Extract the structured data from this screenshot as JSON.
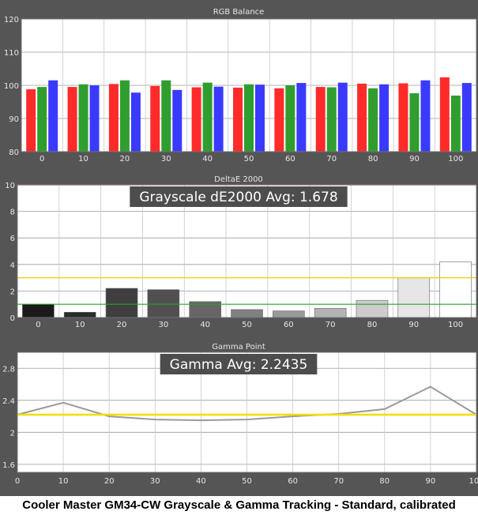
{
  "caption": "Cooler Master GM34-CW Grayscale & Gamma Tracking - Standard, calibrated",
  "chart_data": [
    {
      "type": "bar",
      "title": "RGB Balance",
      "categories": [
        "0",
        "10",
        "20",
        "30",
        "40",
        "50",
        "60",
        "70",
        "80",
        "90",
        "100"
      ],
      "ylim": [
        80,
        120
      ],
      "yticks": [
        80,
        90,
        100,
        110,
        120
      ],
      "grid": true,
      "series": [
        {
          "color": "#ff2a2a",
          "values": [
            98.8,
            99.5,
            100.4,
            99.8,
            99.4,
            99.3,
            99.1,
            99.5,
            100.5,
            100.6,
            102.4
          ]
        },
        {
          "color": "#2f9e2f",
          "values": [
            99.5,
            100.3,
            101.5,
            101.5,
            100.8,
            100.3,
            100.0,
            99.4,
            99.1,
            97.6,
            96.9
          ]
        },
        {
          "color": "#3a3aff",
          "values": [
            101.5,
            100.0,
            97.8,
            98.6,
            99.6,
            100.2,
            100.7,
            100.8,
            100.3,
            101.5,
            100.7
          ]
        }
      ]
    },
    {
      "type": "bar",
      "title": "DeltaE 2000",
      "annotation": "Grayscale dE2000 Avg: 1.678",
      "categories": [
        "0",
        "10",
        "20",
        "30",
        "40",
        "50",
        "60",
        "70",
        "80",
        "90",
        "100"
      ],
      "ylim": [
        0,
        10
      ],
      "yticks": [
        0,
        2,
        4,
        6,
        8,
        10
      ],
      "grid": true,
      "values": [
        1.0,
        0.4,
        2.2,
        2.1,
        1.2,
        0.6,
        0.5,
        0.7,
        1.3,
        3.0,
        4.2
      ],
      "bar_shades": [
        "#1a1a1a",
        "#2b2b2b",
        "#3e3e3e",
        "#505050",
        "#666666",
        "#808080",
        "#999999",
        "#b3b3b3",
        "#cccccc",
        "#e6e6e6",
        "#ffffff"
      ],
      "reference_lines": [
        {
          "y": 10,
          "color": "#e03030"
        },
        {
          "y": 3,
          "color": "#e6d200"
        },
        {
          "y": 1,
          "color": "#2f9e2f"
        }
      ]
    },
    {
      "type": "line",
      "title": "Gamma Point",
      "annotation": "Gamma Avg: 2.2435",
      "x": [
        0,
        10,
        20,
        30,
        40,
        50,
        60,
        70,
        80,
        90,
        100
      ],
      "values": [
        2.22,
        2.37,
        2.2,
        2.16,
        2.15,
        2.16,
        2.2,
        2.23,
        2.29,
        2.57,
        2.22
      ],
      "xlim": [
        0,
        100
      ],
      "xticks": [
        0,
        10,
        20,
        30,
        40,
        50,
        60,
        70,
        80,
        90,
        100
      ],
      "ylim": [
        1.5,
        3.0
      ],
      "yticks": [
        1.6,
        2,
        2.4,
        2.8
      ],
      "grid": true,
      "line_color": "#9a9a9a",
      "reference_lines": [
        {
          "y": 2.22,
          "color": "#f0e000"
        }
      ]
    }
  ]
}
